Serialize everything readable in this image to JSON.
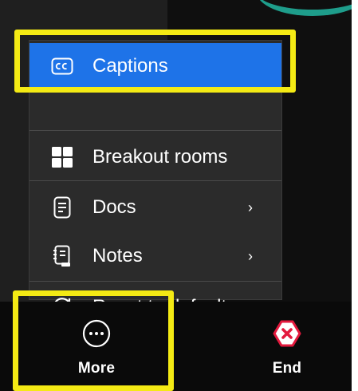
{
  "menu": {
    "items": [
      {
        "label": "Captions",
        "icon": "closed-captions-icon",
        "highlighted": true,
        "has_submenu": false
      },
      {
        "label": "Breakout rooms",
        "icon": "breakout-rooms-icon",
        "highlighted": false,
        "has_submenu": false
      },
      {
        "label": "Docs",
        "icon": "docs-icon",
        "highlighted": false,
        "has_submenu": true
      },
      {
        "label": "Notes",
        "icon": "notes-icon",
        "highlighted": false,
        "has_submenu": true
      },
      {
        "label": "Reset to default",
        "icon": "reset-icon",
        "highlighted": false,
        "has_submenu": false
      }
    ],
    "submenu_chevron": "›"
  },
  "controls": {
    "more": {
      "label": "More",
      "icon": "more-options-icon"
    },
    "end": {
      "label": "End",
      "icon": "end-call-icon"
    }
  },
  "colors": {
    "menu_bg": "#2b2b2b",
    "selected_bg": "#1e73e8",
    "highlight": "#f4ea14",
    "end_red": "#e3193d",
    "bar_bg": "#0a0a0a"
  }
}
